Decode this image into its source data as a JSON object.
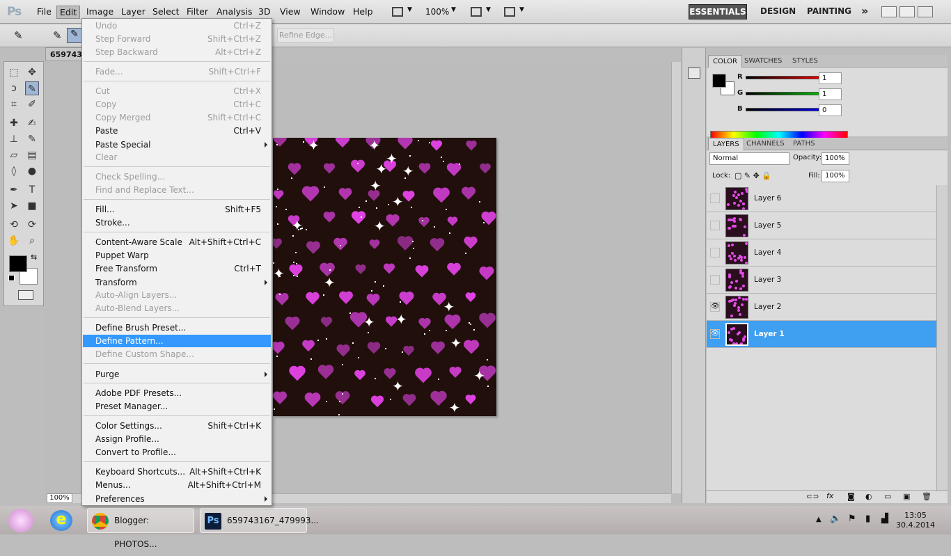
{
  "menubar": {
    "logo": "Ps",
    "items": [
      "File",
      "Edit",
      "Image",
      "Layer",
      "Select",
      "Filter",
      "Analysis",
      "3D",
      "View",
      "Window",
      "Help"
    ],
    "zoom": "100%",
    "workspaces": [
      "ESSENTIALS",
      "DESIGN",
      "PAINTING"
    ],
    "more": "»"
  },
  "options_bar": {
    "refine_edge": "Refine Edge..."
  },
  "document": {
    "tab": "6597431",
    "zoom_box": "100%"
  },
  "edit_menu": {
    "undo": {
      "label": "Undo",
      "shortcut": "Ctrl+Z"
    },
    "step_forward": {
      "label": "Step Forward",
      "shortcut": "Shift+Ctrl+Z"
    },
    "step_backward": {
      "label": "Step Backward",
      "shortcut": "Alt+Ctrl+Z"
    },
    "fade": {
      "label": "Fade...",
      "shortcut": "Shift+Ctrl+F"
    },
    "cut": {
      "label": "Cut",
      "shortcut": "Ctrl+X"
    },
    "copy": {
      "label": "Copy",
      "shortcut": "Ctrl+C"
    },
    "copy_merged": {
      "label": "Copy Merged",
      "shortcut": "Shift+Ctrl+C"
    },
    "paste": {
      "label": "Paste",
      "shortcut": "Ctrl+V"
    },
    "paste_special": {
      "label": "Paste Special"
    },
    "clear": {
      "label": "Clear"
    },
    "check_spelling": {
      "label": "Check Spelling..."
    },
    "find_replace": {
      "label": "Find and Replace Text..."
    },
    "fill": {
      "label": "Fill...",
      "shortcut": "Shift+F5"
    },
    "stroke": {
      "label": "Stroke..."
    },
    "content_aware": {
      "label": "Content-Aware Scale",
      "shortcut": "Alt+Shift+Ctrl+C"
    },
    "puppet_warp": {
      "label": "Puppet Warp"
    },
    "free_transform": {
      "label": "Free Transform",
      "shortcut": "Ctrl+T"
    },
    "transform": {
      "label": "Transform"
    },
    "auto_align": {
      "label": "Auto-Align Layers..."
    },
    "auto_blend": {
      "label": "Auto-Blend Layers..."
    },
    "define_brush": {
      "label": "Define Brush Preset..."
    },
    "define_pattern": {
      "label": "Define Pattern..."
    },
    "define_shape": {
      "label": "Define Custom Shape..."
    },
    "purge": {
      "label": "Purge"
    },
    "pdf_presets": {
      "label": "Adobe PDF Presets..."
    },
    "preset_manager": {
      "label": "Preset Manager..."
    },
    "color_settings": {
      "label": "Color Settings...",
      "shortcut": "Shift+Ctrl+K"
    },
    "assign_profile": {
      "label": "Assign Profile..."
    },
    "convert_profile": {
      "label": "Convert to Profile..."
    },
    "keyboard_shortcuts": {
      "label": "Keyboard Shortcuts...",
      "shortcut": "Alt+Shift+Ctrl+K"
    },
    "menus": {
      "label": "Menus...",
      "shortcut": "Alt+Shift+Ctrl+M"
    },
    "preferences": {
      "label": "Preferences"
    }
  },
  "color_panel": {
    "tabs": [
      "COLOR",
      "SWATCHES",
      "STYLES"
    ],
    "r_label": "R",
    "g_label": "G",
    "b_label": "B",
    "r": "1",
    "g": "1",
    "b": "0",
    "foreground": "#000000",
    "background": "#ffffff"
  },
  "layers_panel": {
    "tabs": [
      "LAYERS",
      "CHANNELS",
      "PATHS"
    ],
    "blend_mode": "Normal",
    "opacity_label": "Opacity:",
    "opacity": "100%",
    "lock_label": "Lock:",
    "fill_label": "Fill:",
    "fill": "100%",
    "layers": [
      {
        "name": "Layer 6",
        "visible": false
      },
      {
        "name": "Layer 5",
        "visible": false
      },
      {
        "name": "Layer 4",
        "visible": false
      },
      {
        "name": "Layer 3",
        "visible": false
      },
      {
        "name": "Layer 2",
        "visible": true
      },
      {
        "name": "Layer 1",
        "visible": true,
        "selected": true
      }
    ],
    "selected_color": "#3f9ff0"
  },
  "taskbar": {
    "apps": [
      {
        "label": "Blogger: PHOTOS..."
      },
      {
        "label": "659743167_479993..."
      }
    ],
    "time": "13:05",
    "date": "30.4.2014"
  }
}
